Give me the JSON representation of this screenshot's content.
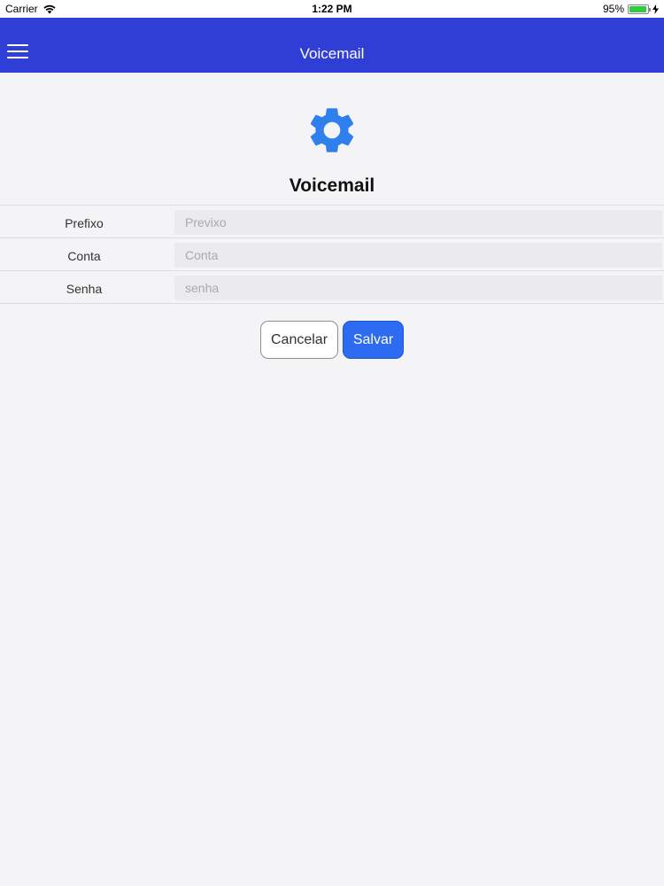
{
  "status_bar": {
    "carrier": "Carrier",
    "time": "1:22 PM",
    "battery": "95%",
    "battery_level": 0.95,
    "icons": [
      "wifi-icon",
      "battery-icon",
      "charging-icon"
    ]
  },
  "nav": {
    "title": "Voicemail",
    "menu_icon": "hamburger-menu-icon",
    "color": "#2f3fd6"
  },
  "header": {
    "icon": "gear-icon",
    "icon_color": "#2f80ed",
    "title": "Voicemail"
  },
  "form": {
    "rows": [
      {
        "label": "Prefixo",
        "placeholder": "Previxo",
        "value": ""
      },
      {
        "label": "Conta",
        "placeholder": "Conta",
        "value": ""
      },
      {
        "label": "Senha",
        "placeholder": "senha",
        "value": ""
      }
    ]
  },
  "actions": {
    "cancel_label": "Cancelar",
    "save_label": "Salvar",
    "save_color": "#2d6bf0"
  }
}
